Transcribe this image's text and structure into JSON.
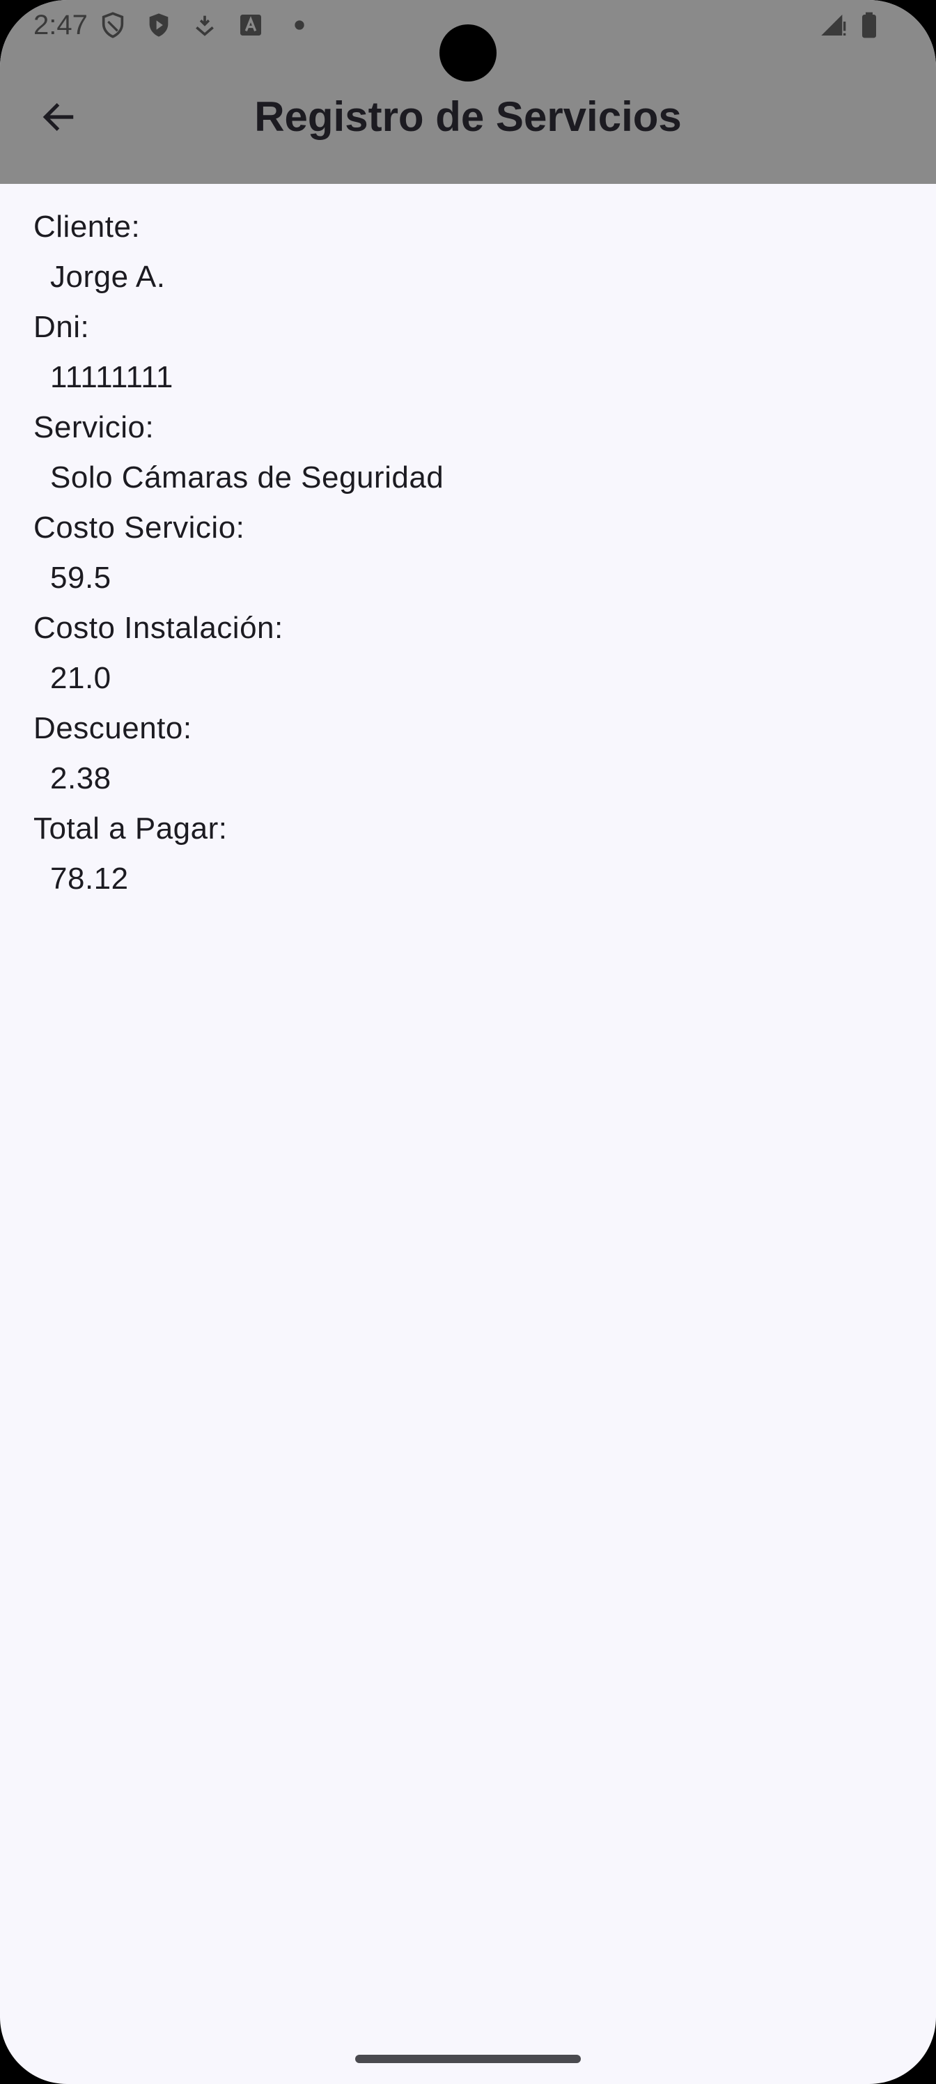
{
  "status_bar": {
    "time": "2:47",
    "left_icons": [
      "shield-outline-icon",
      "shield-play-icon",
      "download-badge-icon",
      "text-a-icon",
      "dot-icon"
    ],
    "right_icons": [
      "signal-icon",
      "battery-icon"
    ]
  },
  "app_bar": {
    "title": "Registro de Servicios",
    "back_icon": "arrow-left-icon"
  },
  "fields": [
    {
      "label": "Cliente:",
      "value": "Jorge A."
    },
    {
      "label": "Dni:",
      "value": "11111111"
    },
    {
      "label": "Servicio:",
      "value": "Solo Cámaras de Seguridad"
    },
    {
      "label": "Costo Servicio:",
      "value": "59.5"
    },
    {
      "label": "Costo Instalación:",
      "value": "21.0"
    },
    {
      "label": "Descuento:",
      "value": "2.38"
    },
    {
      "label": "Total a Pagar:",
      "value": "78.12"
    }
  ],
  "colors": {
    "header_bg": "#8a8a8a",
    "page_bg": "#f8f7fd",
    "text": "#1c1b21"
  }
}
